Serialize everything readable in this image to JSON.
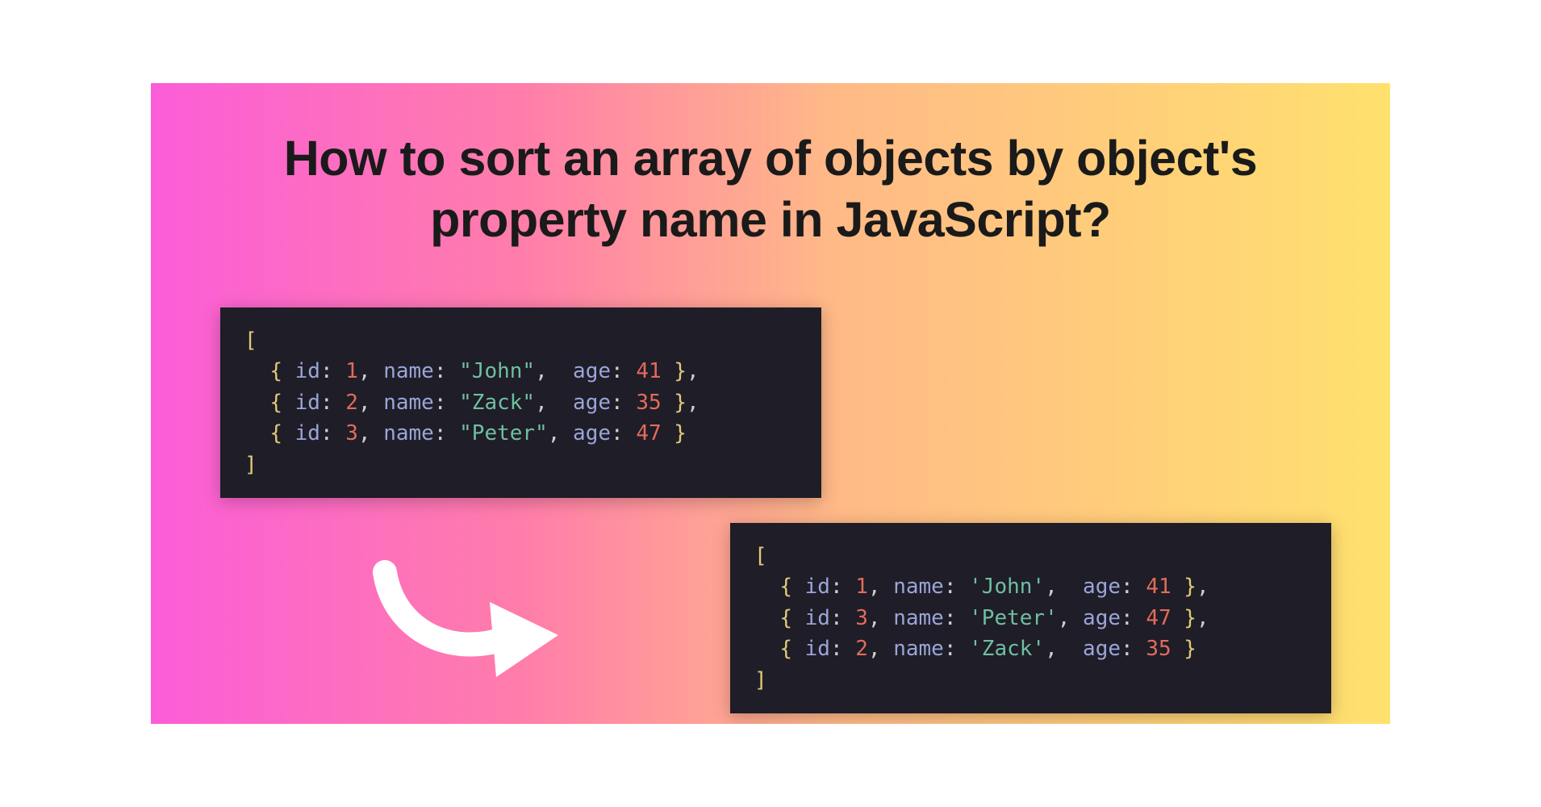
{
  "title": "How to sort an array of objects by object's property name in JavaScript?",
  "code_before": {
    "rows": [
      {
        "id": 1,
        "name": "John",
        "quote": "\"",
        "pad": " ",
        "age": 41,
        "trail": ","
      },
      {
        "id": 2,
        "name": "Zack",
        "quote": "\"",
        "pad": " ",
        "age": 35,
        "trail": ","
      },
      {
        "id": 3,
        "name": "Peter",
        "quote": "\"",
        "pad": "",
        "age": 47,
        "trail": ""
      }
    ]
  },
  "code_after": {
    "rows": [
      {
        "id": 1,
        "name": "John",
        "quote": "'",
        "pad": " ",
        "age": 41,
        "trail": ","
      },
      {
        "id": 3,
        "name": "Peter",
        "quote": "'",
        "pad": "",
        "age": 47,
        "trail": ","
      },
      {
        "id": 2,
        "name": "Zack",
        "quote": "'",
        "pad": " ",
        "age": 35,
        "trail": ""
      }
    ]
  },
  "labels": {
    "id": "id",
    "name": "name",
    "age": "age"
  }
}
